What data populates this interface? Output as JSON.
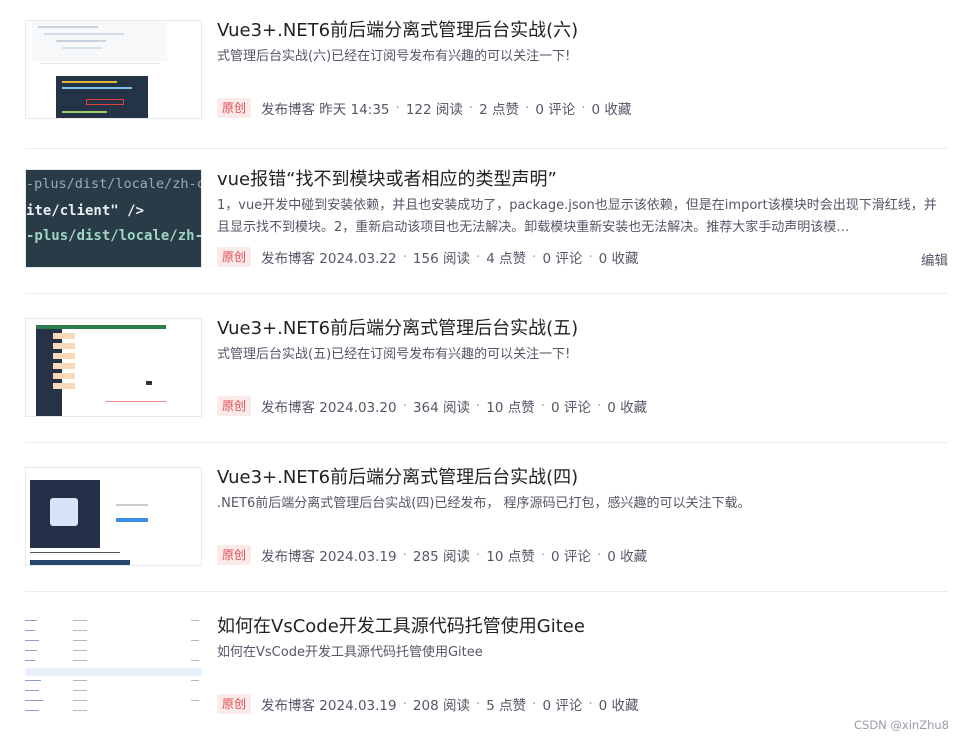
{
  "articles": [
    {
      "title": "Vue3+.NET6前后端分离式管理后台实战(六)",
      "desc": "式管理后台实战(六)已经在订阅号发布有兴趣的可以关注一下!",
      "badge": "原创",
      "published": "发布博客 昨天 14:35",
      "reads": "122 阅读",
      "likes": "2 点赞",
      "comments": "0 评论",
      "favorites": "0 收藏",
      "thumb": "code-screenshot"
    },
    {
      "title": "vue报错“找不到模块或者相应的类型声明”",
      "desc": "1，vue开发中碰到安装依赖，并且也安装成功了，package.json也显示该依赖，但是在import该模块时会出现下滑红线，并且显示找不到模块。2，重新启动该项目也无法解决。卸载模块重新安装也无法解决。推荐大家手动声明该模…",
      "badge": "原创",
      "published": "发布博客 2024.03.22",
      "reads": "156 阅读",
      "likes": "4 点赞",
      "comments": "0 评论",
      "favorites": "0 收藏",
      "edit": "编辑",
      "thumb": "dark-code",
      "thumb_lines": [
        "-plus/dist/locale/zh-cn.mjs",
        "ite/client\" />",
        "-plus/dist/locale/zh-"
      ]
    },
    {
      "title": "Vue3+.NET6前后端分离式管理后台实战(五)",
      "desc": "式管理后台实战(五)已经在订阅号发布有兴趣的可以关注一下!",
      "badge": "原创",
      "published": "发布博客 2024.03.20",
      "reads": "364 阅读",
      "likes": "10 点赞",
      "comments": "0 评论",
      "favorites": "0 收藏",
      "thumb": "admin-ui"
    },
    {
      "title": "Vue3+.NET6前后端分离式管理后台实战(四)",
      "desc": ".NET6前后端分离式管理后台实战(四)已经发布， 程序源码已打包，感兴趣的可以关注下载。",
      "badge": "原创",
      "published": "发布博客 2024.03.19",
      "reads": "285 阅读",
      "likes": "10 点赞",
      "comments": "0 评论",
      "favorites": "0 收藏",
      "thumb": "login-ui"
    },
    {
      "title": "如何在VsCode开发工具源代码托管使用Gitee",
      "desc": "如何在VsCode开发工具源代码托管使用Gitee",
      "badge": "原创",
      "published": "发布博客 2024.03.19",
      "reads": "208 阅读",
      "likes": "5 点赞",
      "comments": "0 评论",
      "favorites": "0 收藏",
      "thumb": "file-list"
    }
  ],
  "watermark": "CSDN @xinZhu8",
  "colors": {
    "badge_bg": "#fbeaea",
    "badge_text": "#e0494f",
    "meta": "#555666",
    "title": "#222226"
  }
}
